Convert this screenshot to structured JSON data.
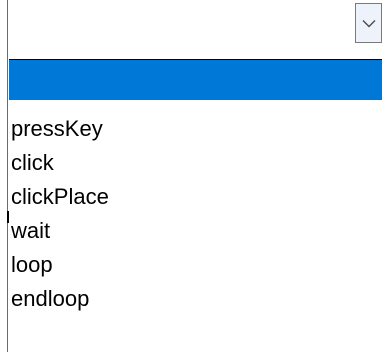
{
  "combo": {
    "value": "",
    "dropdown_icon": "chevron-down-icon"
  },
  "list": {
    "items": [
      {
        "label": "",
        "selected": true
      },
      {
        "label": "pressKey",
        "selected": false
      },
      {
        "label": "click",
        "selected": false
      },
      {
        "label": "clickPlace",
        "selected": false
      },
      {
        "label": "wait",
        "selected": false
      },
      {
        "label": "loop",
        "selected": false
      },
      {
        "label": "endloop",
        "selected": false
      }
    ]
  },
  "colors": {
    "selection": "#0078d7",
    "selection_text": "#ffffff",
    "button_bg": "#eef3fb",
    "border": "#7a7a7a"
  }
}
